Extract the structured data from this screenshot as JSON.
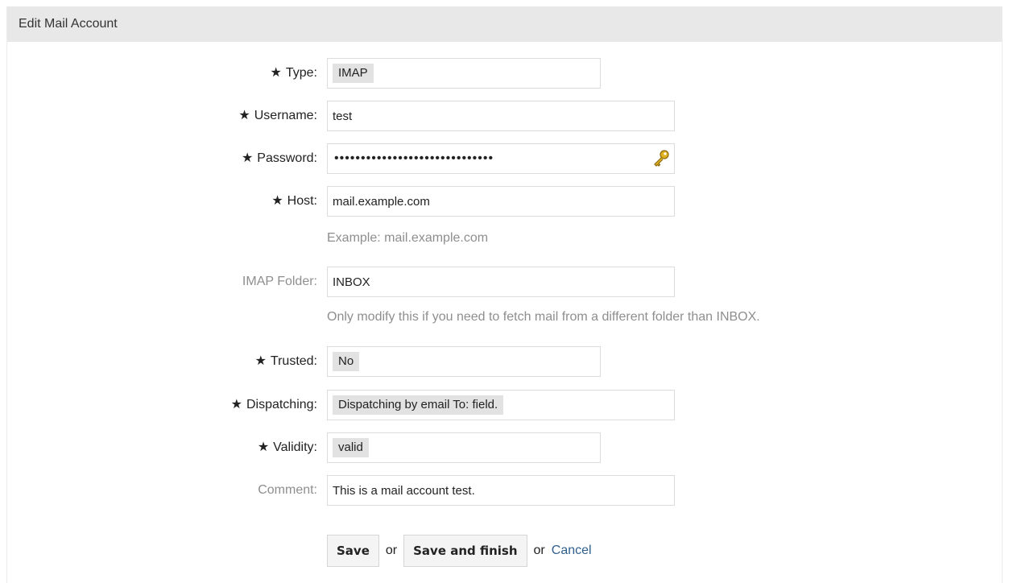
{
  "panel": {
    "title": "Edit Mail Account"
  },
  "form": {
    "required_mark": "★",
    "type": {
      "label": "Type:",
      "value": "IMAP"
    },
    "username": {
      "label": "Username:",
      "value": "test"
    },
    "password": {
      "label": "Password:",
      "value": "••••••••••••••••••••••••••••••"
    },
    "host": {
      "label": "Host:",
      "value": "mail.example.com",
      "hint": "Example: mail.example.com"
    },
    "imap_folder": {
      "label": "IMAP Folder:",
      "value": "INBOX",
      "hint": "Only modify this if you need to fetch mail from a different folder than INBOX."
    },
    "trusted": {
      "label": "Trusted:",
      "value": "No"
    },
    "dispatching": {
      "label": "Dispatching:",
      "value": "Dispatching by email To: field."
    },
    "validity": {
      "label": "Validity:",
      "value": "valid"
    },
    "comment": {
      "label": "Comment:",
      "value": "This is a mail account test."
    }
  },
  "actions": {
    "save_label": "Save",
    "or_label": "or",
    "save_finish_label": "Save and finish",
    "or_cancel_prefix": "or",
    "cancel_label": "Cancel"
  },
  "colors": {
    "header_bg": "#e8e8e8",
    "optional_label": "#8e8e8e",
    "link": "#2f5f8c"
  },
  "icons": {
    "password_icon": "key-icon"
  }
}
